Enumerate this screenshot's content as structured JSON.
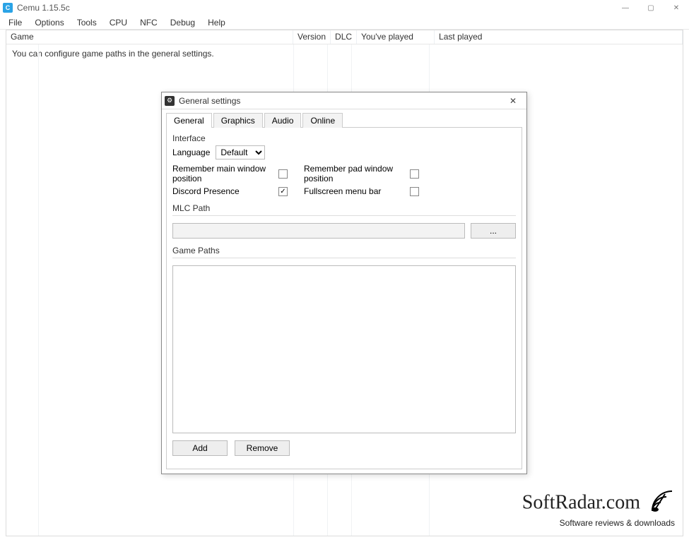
{
  "app": {
    "title": "Cemu 1.15.5c",
    "icon_letter": "C"
  },
  "menu": {
    "items": [
      "File",
      "Options",
      "Tools",
      "CPU",
      "NFC",
      "Debug",
      "Help"
    ]
  },
  "grid": {
    "columns": {
      "game": "Game",
      "version": "Version",
      "dlc": "DLC",
      "played": "You've played",
      "last": "Last played"
    },
    "hint": "You can configure game paths in the general settings."
  },
  "dialog": {
    "title": "General settings",
    "close": "✕",
    "tabs": {
      "general": "General",
      "graphics": "Graphics",
      "audio": "Audio",
      "online": "Online"
    },
    "interface": {
      "legend": "Interface",
      "language_label": "Language",
      "language_value": "Default",
      "remember_main": "Remember main window position",
      "remember_pad": "Remember pad window position",
      "discord": "Discord Presence",
      "fullscreen_menu": "Fullscreen menu bar"
    },
    "mlc": {
      "legend": "MLC Path",
      "browse": "..."
    },
    "gamepaths": {
      "legend": "Game Paths",
      "add": "Add",
      "remove": "Remove"
    }
  },
  "checkbox_states": {
    "remember_main": false,
    "remember_pad": false,
    "discord": true,
    "fullscreen_menu": false
  },
  "watermark": {
    "brand": "SoftRadar.com",
    "tagline": "Software reviews & downloads"
  }
}
